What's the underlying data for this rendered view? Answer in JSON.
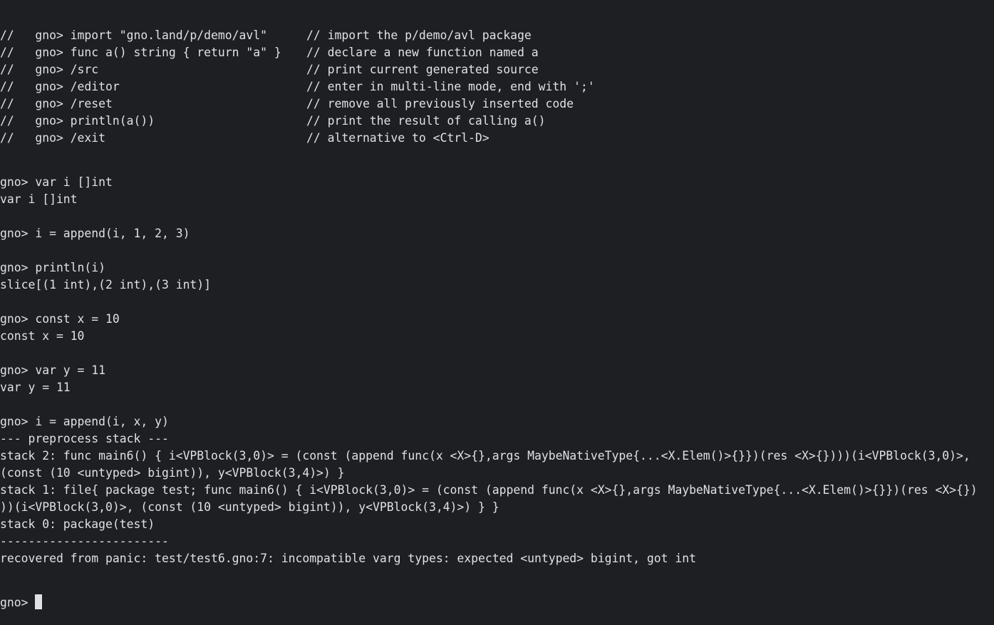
{
  "terminal": {
    "help": [
      {
        "command": "//   gno> import \"gno.land/p/demo/avl\"",
        "comment": "// import the p/demo/avl package"
      },
      {
        "command": "//   gno> func a() string { return \"a\" }",
        "comment": "// declare a new function named a"
      },
      {
        "command": "//   gno> /src",
        "comment": "// print current generated source"
      },
      {
        "command": "//   gno> /editor",
        "comment": "// enter in multi-line mode, end with ';'"
      },
      {
        "command": "//   gno> /reset",
        "comment": "// remove all previously inserted code"
      },
      {
        "command": "//   gno> println(a())",
        "comment": "// print the result of calling a()"
      },
      {
        "command": "//   gno> /exit",
        "comment": "// alternative to <Ctrl-D>"
      }
    ],
    "lines": [
      "gno> var i []int",
      "var i []int",
      "",
      "gno> i = append(i, 1, 2, 3)",
      "",
      "gno> println(i)",
      "slice[(1 int),(2 int),(3 int)]",
      "",
      "gno> const x = 10",
      "const x = 10",
      "",
      "gno> var y = 11",
      "var y = 11",
      "",
      "gno> i = append(i, x, y)",
      "--- preprocess stack ---",
      "stack 2: func main6() { i<VPBlock(3,0)> = (const (append func(x <X>{},args MaybeNativeType{...<X.Elem()>{}})(res <X>{})))(i<VPBlock(3,0)>,",
      "(const (10 <untyped> bigint)), y<VPBlock(3,4)>) }",
      "stack 1: file{ package test; func main6() { i<VPBlock(3,0)> = (const (append func(x <X>{},args MaybeNativeType{...<X.Elem()>{}})(res <X>{})",
      "))(i<VPBlock(3,0)>, (const (10 <untyped> bigint)), y<VPBlock(3,4)>) } }",
      "stack 0: package(test)",
      "------------------------",
      "recovered from panic: test/test6.gno:7: incompatible varg types: expected <untyped> bigint, got int"
    ],
    "prompt": "gno>"
  },
  "colors": {
    "background": "#1e1f22",
    "foreground": "#dfe1e5"
  }
}
